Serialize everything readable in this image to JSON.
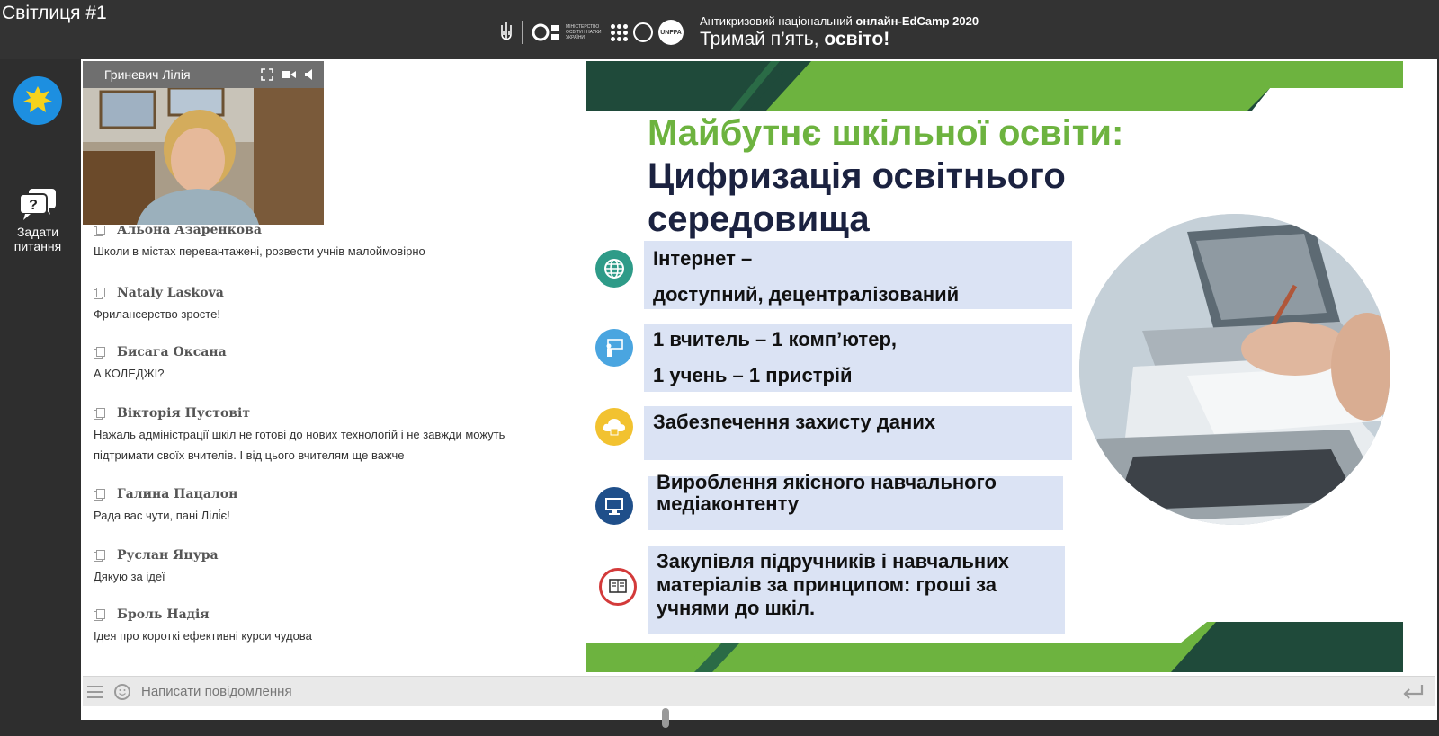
{
  "header": {
    "room_title": "Світлиця #1",
    "ministry_text": "Міністерство освіти і науки України",
    "unfpa": "UNFPA",
    "edcamp_prefix": "Антикризовий національний ",
    "edcamp_bold": "онлайн-EdCamp 2020",
    "slogan_prefix": "Тримай п’ять, ",
    "slogan_bold": "освіто!"
  },
  "rail": {
    "ask_label_line1": "Задати",
    "ask_label_line2": "питання"
  },
  "video": {
    "speaker_name": "Гриневич Лілія"
  },
  "chat": {
    "messages": [
      {
        "author": "Альона Азаренкова",
        "text": "Школи в містах перевантажені, розвести учнів малоймовірно"
      },
      {
        "author": "Nataly Laskova",
        "text": "Фрилансерство зросте!"
      },
      {
        "author": "Бисага Оксана",
        "text": "А КОЛЕДЖІ?"
      },
      {
        "author": "Вікторія Пустовіт",
        "text": "Нажаль адміністрації шкіл не готові до нових технологій і не завжди можуть підтримати своїх вчителів. І від цього вчителям ще важче"
      },
      {
        "author": "Галина Пацалон",
        "text": "Рада вас чути, пані Лілі́є!"
      },
      {
        "author": "Руслан Яцура",
        "text": "Дякую за ідеї"
      },
      {
        "author": "Броль Надія",
        "text": "Ідея про короткі ефективні курси чудова"
      }
    ],
    "composer_placeholder": "Написати повідомлення"
  },
  "slide": {
    "title_line1": "Майбутнє шкільної освіти:",
    "title_line2": "Цифризація освітнього",
    "title_line3": "середовища",
    "bullets": [
      {
        "line1": "Інтернет –",
        "line2": " доступний, децентралізований",
        "icon": "globe-icon"
      },
      {
        "line1": "1 вчитель – 1 комп’ютер,",
        "line2": "1 учень – 1 пристрій",
        "icon": "teacher-icon"
      },
      {
        "line1": "Забезпечення захисту даних",
        "line2": "",
        "icon": "cloud-lock-icon"
      },
      {
        "line1": "Вироблення якісного навчального",
        "line2": "медіаконтенту",
        "icon": "monitor-icon"
      },
      {
        "line1": "Закупівля підручників і навчальних",
        "line2": "матеріалів за принципом: гроші за",
        "line3": "учнями до шкіл.",
        "icon": "book-icon"
      }
    ]
  },
  "colors": {
    "slide_green": "#6db33f",
    "slide_dark_green": "#1f4a3a",
    "slide_navy": "#1b2240",
    "bullet_bg": "#dbe3f4",
    "topbar": "#333333"
  }
}
